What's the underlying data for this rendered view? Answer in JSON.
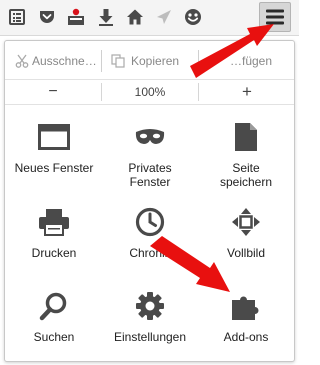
{
  "toolbar": {
    "icons": [
      "reading-list-icon",
      "pocket-icon",
      "screenshot-icon",
      "downloads-icon",
      "home-icon",
      "send-icon",
      "emoji-icon",
      "hamburger-menu-icon"
    ]
  },
  "edit": {
    "cut_label": "Ausschne…",
    "copy_label": "Kopieren",
    "paste_label": "…fügen"
  },
  "zoom": {
    "minus": "−",
    "level": "100%",
    "plus": "+"
  },
  "menu_items": [
    {
      "label": "Neues Fenster",
      "icon": "new-window-icon"
    },
    {
      "label": "Privates\nFenster",
      "icon": "private-mask-icon"
    },
    {
      "label": "Seite\nspeichern",
      "icon": "save-page-icon"
    },
    {
      "label": "Drucken",
      "icon": "printer-icon"
    },
    {
      "label": "Chronik",
      "icon": "history-clock-icon"
    },
    {
      "label": "Vollbild",
      "icon": "fullscreen-icon"
    },
    {
      "label": "Suchen",
      "icon": "search-icon"
    },
    {
      "label": "Einstellungen",
      "icon": "gear-icon"
    },
    {
      "label": "Add-ons",
      "icon": "puzzle-icon"
    }
  ],
  "colors": {
    "icon": "#4a4a4a",
    "annotation_arrow": "#e8100f"
  }
}
